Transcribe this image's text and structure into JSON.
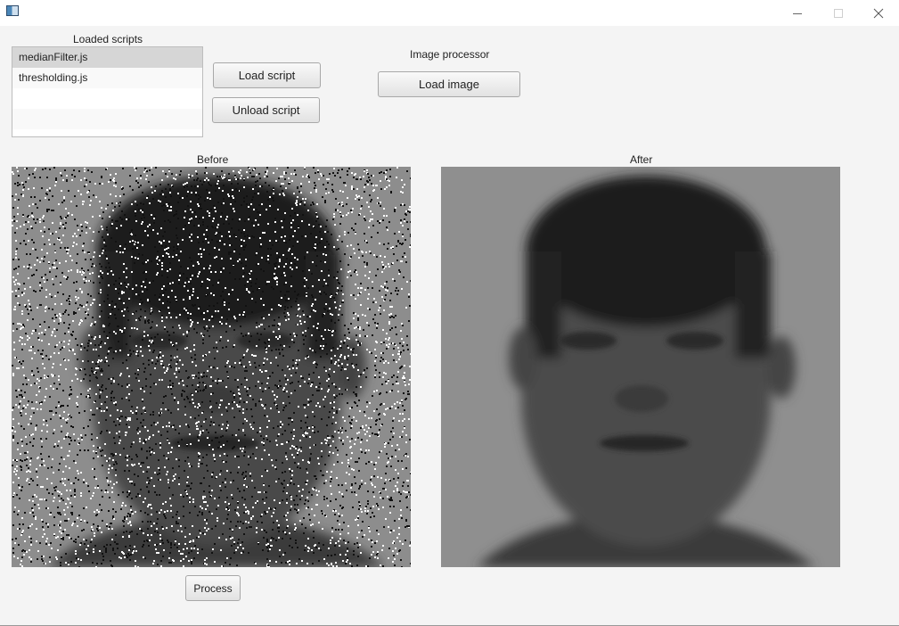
{
  "window": {
    "title": "",
    "controls": {
      "minimize_icon": "minimize-icon",
      "maximize_icon": "maximize-icon",
      "close_icon": "close-icon"
    }
  },
  "scripts_panel": {
    "label": "Loaded scripts",
    "items": [
      "medianFilter.js",
      "thresholding.js"
    ],
    "selected": "medianFilter.js"
  },
  "buttons": {
    "load_script": "Load script",
    "unload_script": "Unload script",
    "load_image": "Load image",
    "process": "Process"
  },
  "image_processor": {
    "label": "Image processor"
  },
  "panels": {
    "before_label": "Before",
    "after_label": "After"
  },
  "colors": {
    "window_bg": "#f4f4f4",
    "titlebar_bg": "#ffffff",
    "selection_bg": "#d6d6d6"
  }
}
